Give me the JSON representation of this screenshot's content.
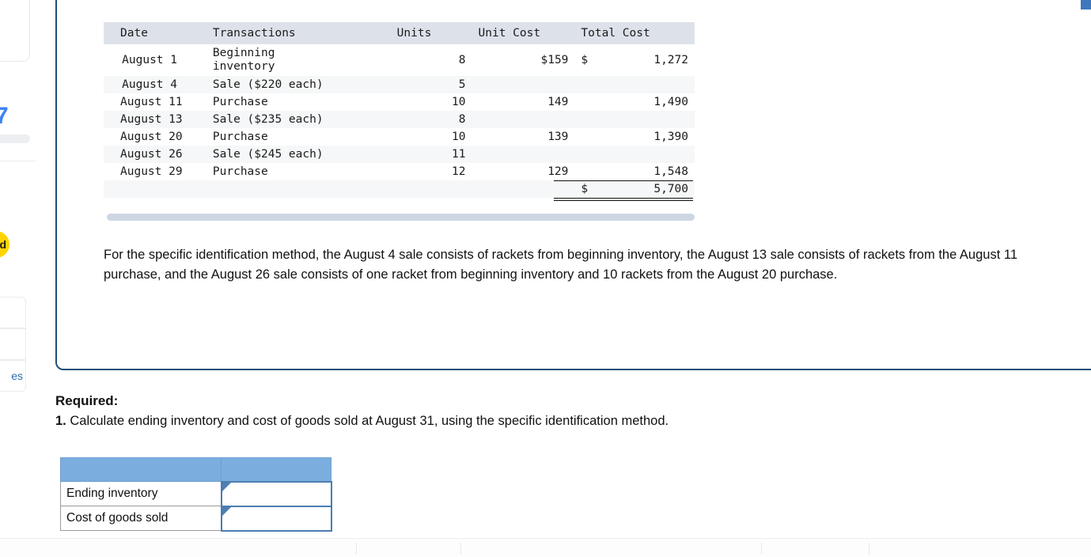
{
  "sidebar": {
    "counter_badge": "7",
    "yellow_button_label": "d",
    "list_card_1_label": "",
    "list_card_2_label": "",
    "list_card_3_label": "es"
  },
  "inventory_table": {
    "headers": [
      "Date",
      "Transactions",
      "Units",
      "Unit Cost",
      "Total Cost"
    ],
    "rows": [
      {
        "date": "August  1",
        "transaction": "Beginning inventory",
        "units": "8",
        "unit_cost": "$159",
        "dollar": "$",
        "total_cost": "1,272"
      },
      {
        "date": "August  4",
        "transaction": "Sale ($220 each)",
        "units": "5",
        "unit_cost": "",
        "dollar": "",
        "total_cost": ""
      },
      {
        "date": "August 11",
        "transaction": "Purchase",
        "units": "10",
        "unit_cost": "149",
        "dollar": "",
        "total_cost": "1,490"
      },
      {
        "date": "August 13",
        "transaction": "Sale ($235 each)",
        "units": "8",
        "unit_cost": "",
        "dollar": "",
        "total_cost": ""
      },
      {
        "date": "August 20",
        "transaction": "Purchase",
        "units": "10",
        "unit_cost": "139",
        "dollar": "",
        "total_cost": "1,390"
      },
      {
        "date": "August 26",
        "transaction": "Sale ($245 each)",
        "units": "11",
        "unit_cost": "",
        "dollar": "",
        "total_cost": ""
      },
      {
        "date": "August 29",
        "transaction": "Purchase",
        "units": "12",
        "unit_cost": "129",
        "dollar": "",
        "total_cost": "1,548"
      }
    ],
    "total_row": {
      "dollar": "$",
      "total_cost": "5,700"
    }
  },
  "narrative": "For the specific identification method, the August 4 sale consists of rackets from beginning inventory, the August 13 sale consists of rackets from the August 11 purchase, and the August 26 sale consists of one racket from beginning inventory and 10 rackets from the August 20 purchase.",
  "required": {
    "label": "Required:",
    "item_number": "1.",
    "item_text": " Calculate ending inventory and cost of goods sold at August 31, using the specific identification method."
  },
  "answer_table": {
    "header_col1": "",
    "header_col2": "",
    "rows": [
      {
        "label": "Ending inventory",
        "value": ""
      },
      {
        "label": "Cost of goods sold",
        "value": ""
      }
    ]
  },
  "colors": {
    "panel_border": "#1f4e79",
    "table_header_bg": "#dde2ea",
    "answer_header_bg": "#7badde",
    "input_border": "#4b7cb0",
    "accent_yellow": "#ffd400",
    "accent_blue": "#3b82f6"
  }
}
